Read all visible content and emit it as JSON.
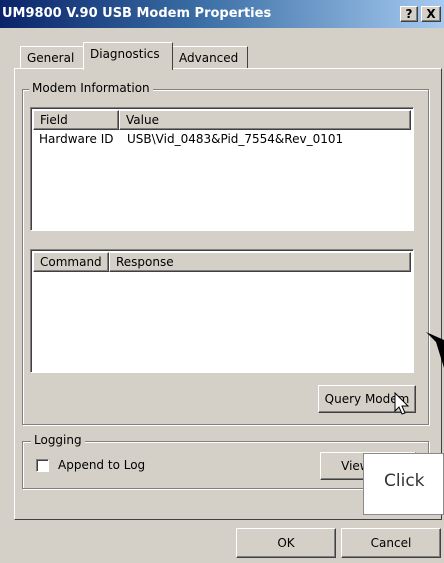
{
  "window": {
    "title": "UM9800 V.90 USB Modem Properties",
    "help_label": "?",
    "close_label": "X"
  },
  "tabs": [
    {
      "label": "General",
      "active": false
    },
    {
      "label": "Diagnostics",
      "active": true
    },
    {
      "label": "Advanced",
      "active": false
    }
  ],
  "modem_info": {
    "group_label": "Modem Information",
    "info_list": {
      "columns": [
        "Field",
        "Value"
      ],
      "rows": [
        [
          "Hardware ID",
          "USB\\Vid_0483&Pid_7554&Rev_0101"
        ]
      ]
    },
    "command_list": {
      "columns": [
        "Command",
        "Response"
      ],
      "rows": []
    },
    "query_button": "Query Modem"
  },
  "logging": {
    "group_label": "Logging",
    "append_label": "Append to Log",
    "append_checked": false,
    "view_log_button": "View Log"
  },
  "footer": {
    "ok_label": "OK",
    "cancel_label": "Cancel"
  },
  "callout": {
    "text": "Click"
  },
  "icons": {
    "pointer_arrow": "arrow-pointer-icon",
    "cursor": "mouse-cursor-icon"
  },
  "colors": {
    "title_start": "#0a246a",
    "title_end": "#a6caf0",
    "face": "#d4d0c8"
  }
}
